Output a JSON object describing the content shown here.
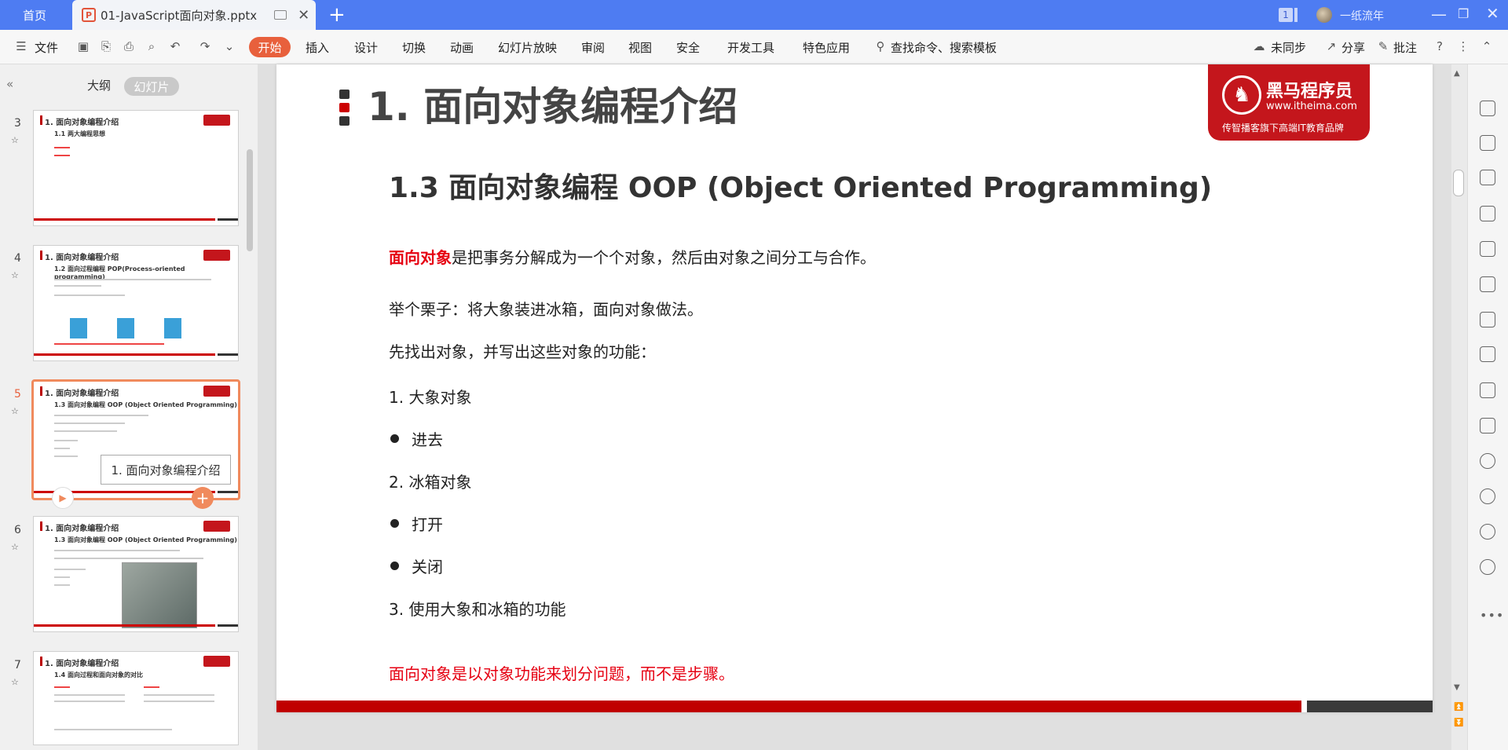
{
  "titlebar": {
    "home_tab": "首页",
    "doc_tab": "01-JavaScript面向对象.pptx",
    "ppt_icon": "P",
    "new_tab": "+",
    "badge": "1",
    "user_name": "一纸流年",
    "min": "—",
    "max": "❐",
    "close": "✕"
  },
  "menubar": {
    "file": "文件",
    "start": "开始",
    "items": [
      "插入",
      "设计",
      "切换",
      "动画",
      "幻灯片放映",
      "审阅",
      "视图",
      "安全",
      "开发工具",
      "特色应用"
    ],
    "search": "查找命令、搜索模板",
    "sync": "未同步",
    "share": "分享",
    "comment": "批注"
  },
  "sidebar": {
    "tab_outline": "大纲",
    "tab_slides": "幻灯片",
    "thumbs": [
      {
        "num": "3",
        "title": "1. 面向对象编程介绍",
        "sub": "1.1 两大编程思想"
      },
      {
        "num": "4",
        "title": "1. 面向对象编程介绍",
        "sub": "1.2 面向过程编程 POP(Process-oriented programming)"
      },
      {
        "num": "5",
        "title": "1. 面向对象编程介绍",
        "sub": "1.3 面向对象编程 OOP (Object Oriented Programming)"
      },
      {
        "num": "6",
        "title": "1. 面向对象编程介绍",
        "sub": "1.3 面向对象编程 OOP (Object Oriented Programming)"
      },
      {
        "num": "7",
        "title": "1. 面向对象编程介绍",
        "sub": "1.4 面向过程和面向对象的对比"
      }
    ],
    "tooltip": "1. 面向对象编程介绍"
  },
  "slide": {
    "title": "1. 面向对象编程介绍",
    "subtitle": "1.3 面向对象编程 OOP (Object Oriented Programming)",
    "logo_cn": "黑马程序员",
    "logo_url": "www.itheima.com",
    "logo_tag": "传智播客旗下高端IT教育品牌",
    "p1_hl": "面向对象",
    "p1_rest": "是把事务分解成为一个个对象，然后由对象之间分工与合作。",
    "p2": "举个栗子：将大象装进冰箱，面向对象做法。",
    "p3": "先找出对象，并写出这些对象的功能：",
    "l1": "1. 大象对象",
    "b1": "进去",
    "l2": "2. 冰箱对象",
    "b2": "打开",
    "b3": "关闭",
    "l3": "3.  使用大象和冰箱的功能",
    "conclusion": "面向对象是以对象功能来划分问题，而不是步骤。"
  },
  "colors": {
    "titlebar": "#4e7cf2",
    "accent": "#e8603c",
    "brand_red": "#c4161c"
  }
}
